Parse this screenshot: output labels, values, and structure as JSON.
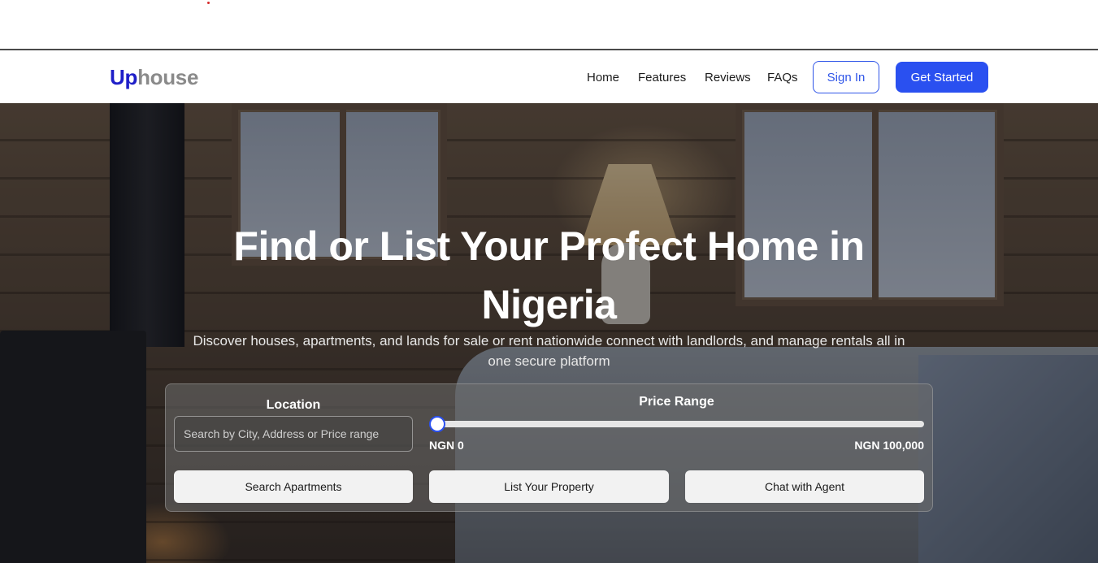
{
  "brand": {
    "logo_part1": "Up",
    "logo_part2": "house",
    "accent": "#2a50f0",
    "logo_color": "#1f1fc8"
  },
  "nav": {
    "links": [
      "Home",
      "Features",
      "Reviews",
      "FAQs"
    ],
    "signin_label": "Sign In",
    "get_started_label": "Get Started"
  },
  "hero": {
    "title_line1": "Find or List Your Profect Home in",
    "title_line2": "Nigeria",
    "subtitle_line1": "Discover houses, apartments, and lands for sale or rent nationwide connect with landlords, and manage rentals all in",
    "subtitle_line2": "one secure platform"
  },
  "search": {
    "location_label": "Location",
    "location_placeholder": "Search by City, Address or Price range",
    "price_label": "Price Range",
    "price_min_label": "NGN 0",
    "price_max_label": "NGN 100,000",
    "price_value": 0,
    "buttons": [
      "Search Apartments",
      "List Your Property",
      "Chat with Agent"
    ]
  }
}
